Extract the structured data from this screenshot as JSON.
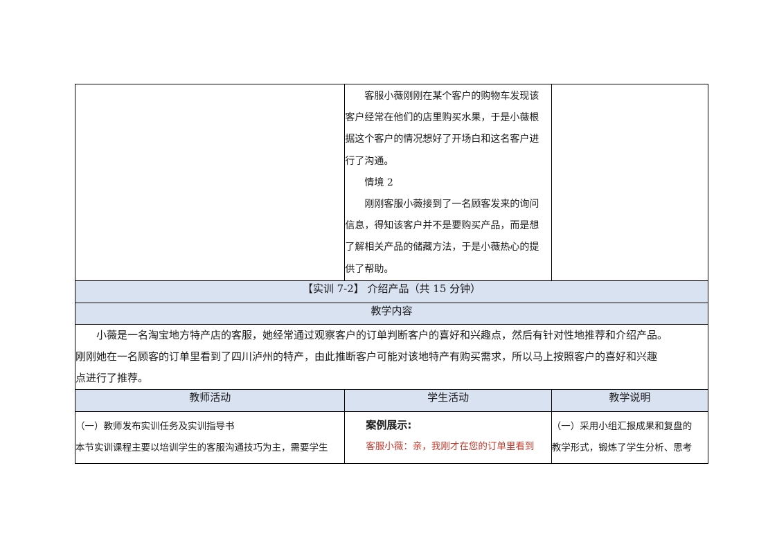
{
  "scenario_column": {
    "paragraphs": [
      "客服小薇刚刚在某个客户的购物车发现该客户经常在他们的店里购买水果，于是小薇根据这个客户的情况想好了开场白和这名客户进行了沟通。",
      "情境 2",
      "刚刚客服小薇接到了一名顾客发来的询问信息，得知该客户并不是要购买产品，而是想了解相关产品的储藏方法，于是小薇热心的提供了帮助。"
    ],
    "lines": [
      "客服小薇刚刚在某个客户的购物车发现该",
      "客户经常在他们的店里购买水果，于是小薇根",
      "据这个客户的情况想好了开场白和这名客户进",
      "行了沟通。",
      "情境 2",
      "刚刚客服小薇接到了一名顾客发来的询问",
      "信息，得知该客户并不是要购买产品，而是想",
      "了解相关产品的储藏方法，于是小薇热心的提",
      "供了帮助。"
    ]
  },
  "section_title": "【实训 7-2】 介绍产品（共 15 分钟）",
  "content_header": "教学内容",
  "content_lines": [
    "小薇是一名淘宝地方特产店的客服，她经常通过观察客户的订单判断客户的喜好和兴趣点，然后有针对性地推荐和介绍产品。",
    "刚刚她在一名顾客的订单里看到了四川泸州的特产，由此推断客户可能对该地特产有购买需求，所以马上按照客户的喜好和兴趣",
    "点进行了推荐。"
  ],
  "columns": [
    "教师活动",
    "学生活动",
    "教学说明"
  ],
  "teacher_activity": {
    "line1": "（一）教师发布实训任务及实训指导书",
    "line2": "本节实训课程主要以培训学生的客服沟通技巧为主，需要学生"
  },
  "student_activity": {
    "case_title": "案例展示:",
    "line1": "客服小薇：亲，我刚才在您的订单里看到"
  },
  "teaching_note": {
    "line1": "（一）采用小组汇报成果和复盘的",
    "line2": "教学形式，锻炼了学生分析、思考"
  },
  "colors": {
    "band": "#d9e2f1",
    "red_text": "#c0392b",
    "border": "#000000"
  }
}
